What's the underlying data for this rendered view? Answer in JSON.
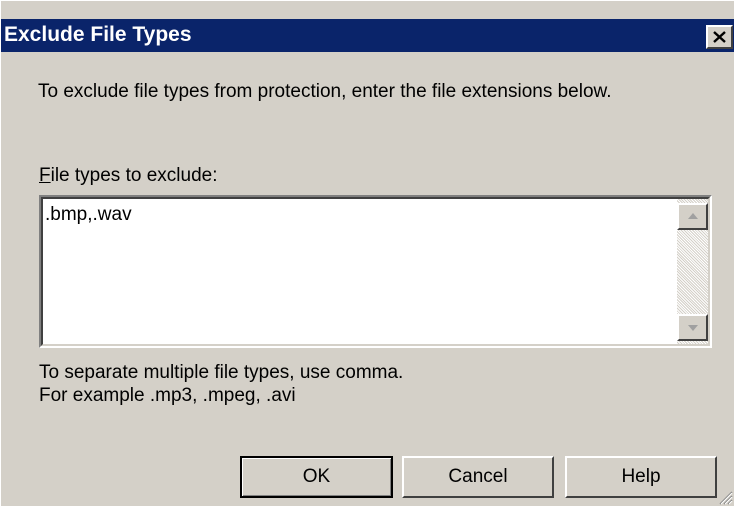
{
  "window": {
    "title": "Exclude File Types",
    "close_symbol": "×"
  },
  "instructions": "To exclude file types from protection, enter the file extensions below.",
  "field": {
    "label_accel": "F",
    "label_rest": "ile types to exclude:",
    "value": ".bmp,.wav"
  },
  "hint": {
    "line1": "To separate multiple file types, use comma.",
    "line2": "For example .mp3, .mpeg, .avi"
  },
  "buttons": {
    "ok": "OK",
    "cancel": "Cancel",
    "help": "Help"
  },
  "icons": {
    "close": "close-icon",
    "scroll_up": "arrow-up-icon",
    "scroll_down": "arrow-down-icon",
    "resize": "resize-grip-icon"
  },
  "colors": {
    "titlebar": "#0a246a",
    "face": "#d4d0c8",
    "title_text": "#ffffff"
  }
}
